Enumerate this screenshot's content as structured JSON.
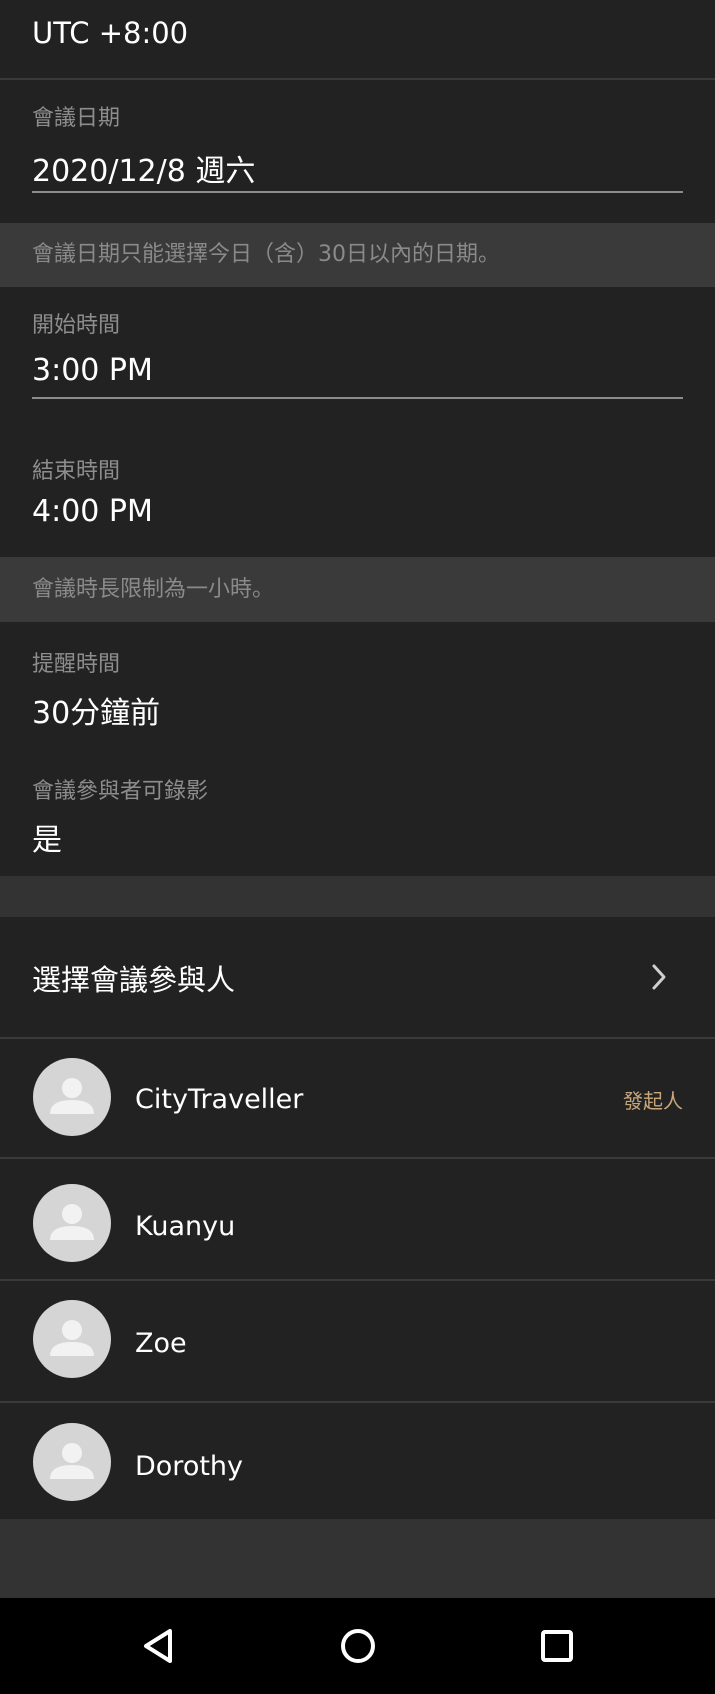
{
  "timezone": {
    "value": "UTC +8:00"
  },
  "meeting_date": {
    "label": "會議日期",
    "value": "2020/12/8 週六",
    "note": "會議日期只能選擇今日（含）30日以內的日期。"
  },
  "start_time": {
    "label": "開始時間",
    "value": "3:00 PM"
  },
  "end_time": {
    "label": "結束時間",
    "value": "4:00 PM",
    "note": "會議時長限制為一小時。"
  },
  "reminder": {
    "label": "提醒時間",
    "value": "30分鐘前"
  },
  "recording": {
    "label": "會議參與者可錄影",
    "value": "是"
  },
  "participants": {
    "header": "選擇會議參與人",
    "list": [
      {
        "name": "CityTraveller",
        "badge": "發起人"
      },
      {
        "name": "Kuanyu"
      },
      {
        "name": "Zoe"
      },
      {
        "name": "Dorothy"
      }
    ]
  },
  "icons": {
    "chevron": "chevron-right-icon",
    "avatar": "person-avatar-icon",
    "nav_back": "back-triangle-icon",
    "nav_home": "home-circle-icon",
    "nav_recents": "recents-square-icon"
  },
  "colors": {
    "background": "#222222",
    "separator": "#333333",
    "label": "#8d8d8d",
    "accent_badge": "#c9a77d"
  }
}
